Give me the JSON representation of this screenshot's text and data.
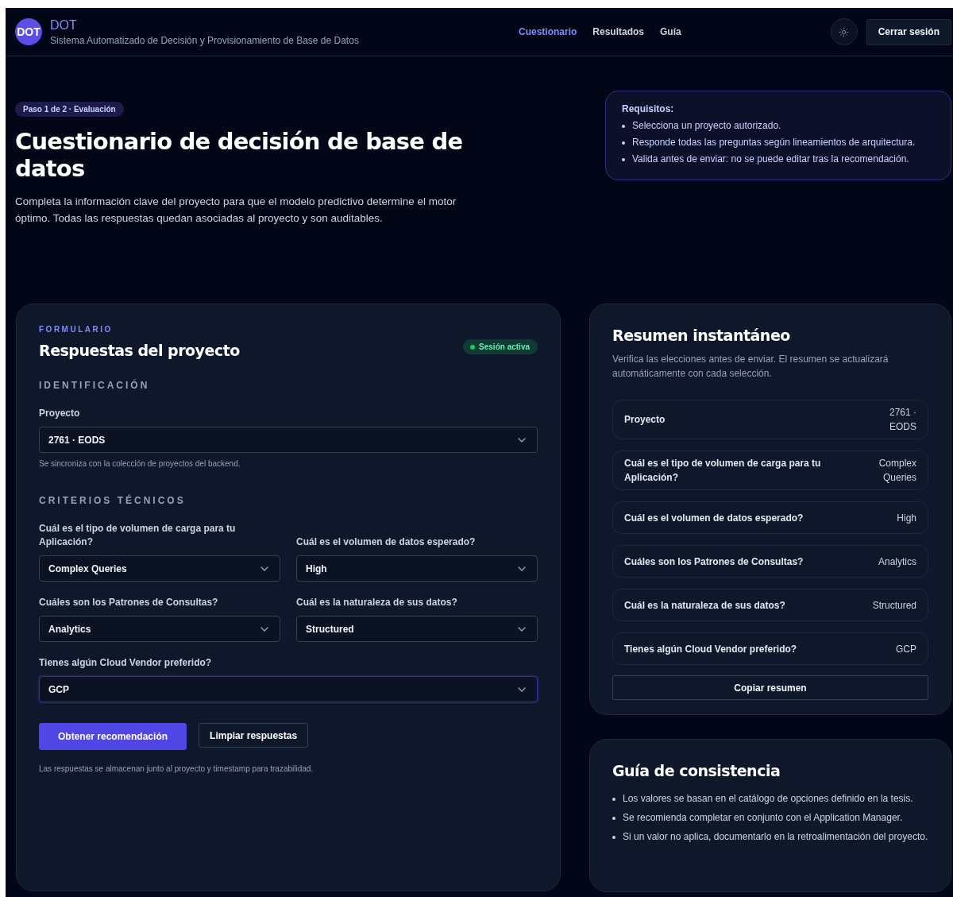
{
  "header": {
    "logo": "DOT",
    "title": "DOT",
    "subtitle": "Sistema Automatizado de Decisión y Provisionamiento de Base de Datos",
    "nav": [
      {
        "label": "Cuestionario",
        "selected": true
      },
      {
        "label": "Resultados",
        "selected": false
      },
      {
        "label": "Guía",
        "selected": false
      }
    ],
    "logout": "Cerrar sesión"
  },
  "hero": {
    "badge": "Paso 1 de 2 · Evaluación",
    "title": "Cuestionario de decisión de base de datos",
    "description": "Completa la información clave del proyecto para que el modelo predictivo determine el motor óptimo. Todas las respuestas quedan asociadas al proyecto y son auditables.",
    "requirements": {
      "title": "Requisitos:",
      "items": [
        "Selecciona un proyecto autorizado.",
        "Responde todas las preguntas según lineamientos de arquitectura.",
        "Valida antes de enviar: no se puede editar tras la recomendación."
      ]
    }
  },
  "form": {
    "eyebrow": "FORMULARIO",
    "title": "Respuestas del proyecto",
    "status": {
      "label": "Sesión activa",
      "color": "#22c55e"
    },
    "sections": [
      {
        "heading": "IDENTIFICACIÓN",
        "hint": "Se sincroniza con la colección de proyectos del backend.",
        "fields": [
          {
            "label": "Proyecto",
            "value": "2761 · EODS",
            "wide": true,
            "focused": false
          }
        ]
      },
      {
        "heading": "CRITERIOS TÉCNICOS",
        "fields": [
          {
            "label": "Cuál es el tipo de volumen de carga para tu Aplicación?",
            "value": "Complex Queries",
            "wide": false,
            "focused": false
          },
          {
            "label": "Cuál es el volumen de datos esperado?",
            "value": "High",
            "wide": false,
            "focused": false
          },
          {
            "label": "Cuáles son los Patrones de Consultas?",
            "value": "Analytics",
            "wide": false,
            "focused": false
          },
          {
            "label": "Cuál es la naturaleza de sus datos?",
            "value": "Structured",
            "wide": false,
            "focused": false
          },
          {
            "label": "Tienes algún Cloud Vendor preferido?",
            "value": "GCP",
            "wide": true,
            "focused": true
          }
        ]
      }
    ],
    "buttons": [
      {
        "label": "Obtener recomendación",
        "kind": "primary"
      },
      {
        "label": "Limpiar respuestas",
        "kind": "secondary"
      }
    ],
    "footnote": "Las respuestas se almacenan junto al proyecto y timestamp para trazabilidad."
  },
  "summary": {
    "title": "Resumen instantáneo",
    "description": "Verifica las elecciones antes de enviar. El resumen se actualizará automáticamente con cada selección.",
    "rows": [
      {
        "label": "Proyecto",
        "value": "2761 · EODS"
      },
      {
        "label": "Cuál es el tipo de volumen de carga para tu Aplicación?",
        "value": "Complex Queries"
      },
      {
        "label": "Cuál es el volumen de datos esperado?",
        "value": "High"
      },
      {
        "label": "Cuáles son los Patrones de Consultas?",
        "value": "Analytics"
      },
      {
        "label": "Cuál es la naturaleza de sus datos?",
        "value": "Structured"
      },
      {
        "label": "Tienes algún Cloud Vendor preferido?",
        "value": "GCP"
      }
    ],
    "copy": "Copiar resumen"
  },
  "guide": {
    "title": "Guía de consistencia",
    "items": [
      "Los valores se basan en el catálogo de opciones definido en la tesis.",
      "Se recomienda completar en conjunto con el Application Manager.",
      "Si un valor no aplica, documentarlo en la retroalimentación del proyecto."
    ]
  }
}
